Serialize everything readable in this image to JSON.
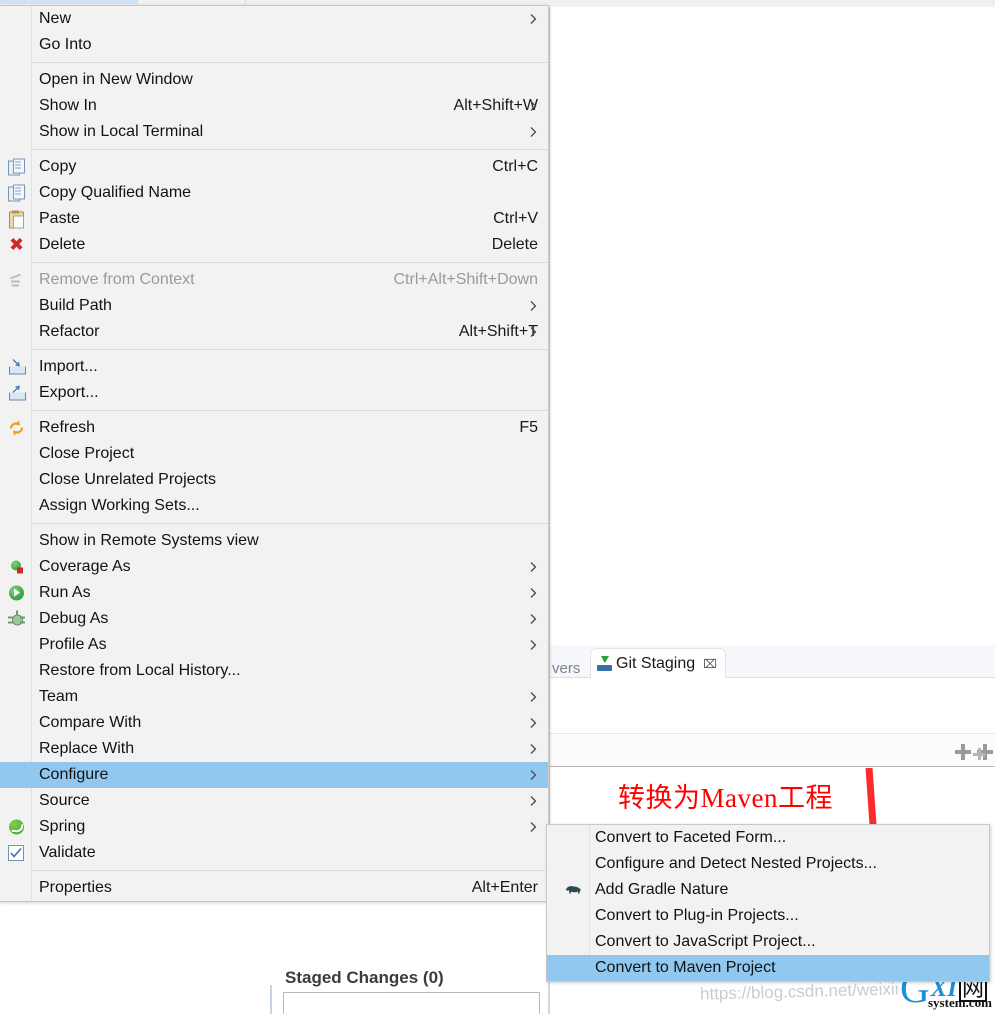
{
  "background": {
    "tab_prev_label": "vers",
    "git_staging_tab": {
      "label": "Git Staging",
      "icon": "git-staging-icon",
      "close": "⌧"
    },
    "staged_changes_label": "Staged Changes (0)",
    "toolbar_icons": [
      "add-icon",
      "add-all-icon"
    ]
  },
  "annotation": {
    "text": "转换为Maven工程",
    "color": "#ff0000",
    "arrow": "red-down-arrow"
  },
  "watermark": {
    "url_text": "https://blog.csdn.net/weixin",
    "logo_g": "G",
    "logo_xi": "XI",
    "logo_wang": "网",
    "logo_sub": "system.com"
  },
  "context_menu": {
    "name": "project-context-menu",
    "items": [
      {
        "label": "New",
        "icon": null,
        "accel": "",
        "submenu": true,
        "type": "item"
      },
      {
        "label": "Go Into",
        "icon": null,
        "accel": "",
        "submenu": false,
        "type": "item"
      },
      {
        "type": "separator"
      },
      {
        "label": "Open in New Window",
        "icon": null,
        "accel": "",
        "submenu": false,
        "type": "item"
      },
      {
        "label": "Show In",
        "icon": null,
        "accel": "Alt+Shift+W",
        "submenu": true,
        "type": "item"
      },
      {
        "label": "Show in Local Terminal",
        "icon": null,
        "accel": "",
        "submenu": true,
        "type": "item"
      },
      {
        "type": "separator"
      },
      {
        "label": "Copy",
        "icon": "copy-icon",
        "accel": "Ctrl+C",
        "submenu": false,
        "type": "item"
      },
      {
        "label": "Copy Qualified Name",
        "icon": "copy-qualified-name-icon",
        "accel": "",
        "submenu": false,
        "type": "item"
      },
      {
        "label": "Paste",
        "icon": "paste-icon",
        "accel": "Ctrl+V",
        "submenu": false,
        "type": "item"
      },
      {
        "label": "Delete",
        "icon": "delete-icon",
        "accel": "Delete",
        "submenu": false,
        "type": "item"
      },
      {
        "type": "separator"
      },
      {
        "label": "Remove from Context",
        "icon": "remove-from-context-icon",
        "accel": "Ctrl+Alt+Shift+Down",
        "submenu": false,
        "type": "item",
        "disabled": true
      },
      {
        "label": "Build Path",
        "icon": null,
        "accel": "",
        "submenu": true,
        "type": "item"
      },
      {
        "label": "Refactor",
        "icon": null,
        "accel": "Alt+Shift+T",
        "submenu": true,
        "type": "item"
      },
      {
        "type": "separator"
      },
      {
        "label": "Import...",
        "icon": "import-icon",
        "accel": "",
        "submenu": false,
        "type": "item"
      },
      {
        "label": "Export...",
        "icon": "export-icon",
        "accel": "",
        "submenu": false,
        "type": "item"
      },
      {
        "type": "separator"
      },
      {
        "label": "Refresh",
        "icon": "refresh-icon",
        "accel": "F5",
        "submenu": false,
        "type": "item"
      },
      {
        "label": "Close Project",
        "icon": null,
        "accel": "",
        "submenu": false,
        "type": "item"
      },
      {
        "label": "Close Unrelated Projects",
        "icon": null,
        "accel": "",
        "submenu": false,
        "type": "item"
      },
      {
        "label": "Assign Working Sets...",
        "icon": null,
        "accel": "",
        "submenu": false,
        "type": "item"
      },
      {
        "type": "separator"
      },
      {
        "label": "Show in Remote Systems view",
        "icon": null,
        "accel": "",
        "submenu": false,
        "type": "item"
      },
      {
        "label": "Coverage As",
        "icon": "coverage-icon",
        "accel": "",
        "submenu": true,
        "type": "item"
      },
      {
        "label": "Run As",
        "icon": "run-icon",
        "accel": "",
        "submenu": true,
        "type": "item"
      },
      {
        "label": "Debug As",
        "icon": "debug-icon",
        "accel": "",
        "submenu": true,
        "type": "item"
      },
      {
        "label": "Profile As",
        "icon": null,
        "accel": "",
        "submenu": true,
        "type": "item"
      },
      {
        "label": "Restore from Local History...",
        "icon": null,
        "accel": "",
        "submenu": false,
        "type": "item"
      },
      {
        "label": "Team",
        "icon": null,
        "accel": "",
        "submenu": true,
        "type": "item"
      },
      {
        "label": "Compare With",
        "icon": null,
        "accel": "",
        "submenu": true,
        "type": "item"
      },
      {
        "label": "Replace With",
        "icon": null,
        "accel": "",
        "submenu": true,
        "type": "item"
      },
      {
        "label": "Configure",
        "icon": null,
        "accel": "",
        "submenu": true,
        "type": "item",
        "selected": true
      },
      {
        "label": "Source",
        "icon": null,
        "accel": "",
        "submenu": true,
        "type": "item"
      },
      {
        "label": "Spring",
        "icon": "spring-icon",
        "accel": "",
        "submenu": true,
        "type": "item"
      },
      {
        "label": "Validate",
        "icon": "validate-checkbox-icon",
        "accel": "",
        "submenu": false,
        "type": "item"
      },
      {
        "type": "separator"
      },
      {
        "label": "Properties",
        "icon": null,
        "accel": "Alt+Enter",
        "submenu": false,
        "type": "item"
      }
    ]
  },
  "configure_submenu": {
    "name": "configure-submenu",
    "items": [
      {
        "label": "Convert to Faceted Form...",
        "icon": null,
        "type": "item"
      },
      {
        "label": "Configure and Detect Nested Projects...",
        "icon": null,
        "type": "item"
      },
      {
        "label": "Add Gradle Nature",
        "icon": "gradle-elephant-icon",
        "type": "item"
      },
      {
        "label": "Convert to Plug-in Projects...",
        "icon": null,
        "type": "item"
      },
      {
        "label": "Convert to JavaScript Project...",
        "icon": null,
        "type": "item"
      },
      {
        "label": "Convert to Maven Project",
        "icon": null,
        "type": "item",
        "selected": true
      }
    ]
  },
  "colors": {
    "menu_bg": "#f2f2f2",
    "highlight": "#90c8f0",
    "annotation_red": "#ff0000",
    "text": "#121212",
    "disabled_text": "#9a9a9a"
  }
}
